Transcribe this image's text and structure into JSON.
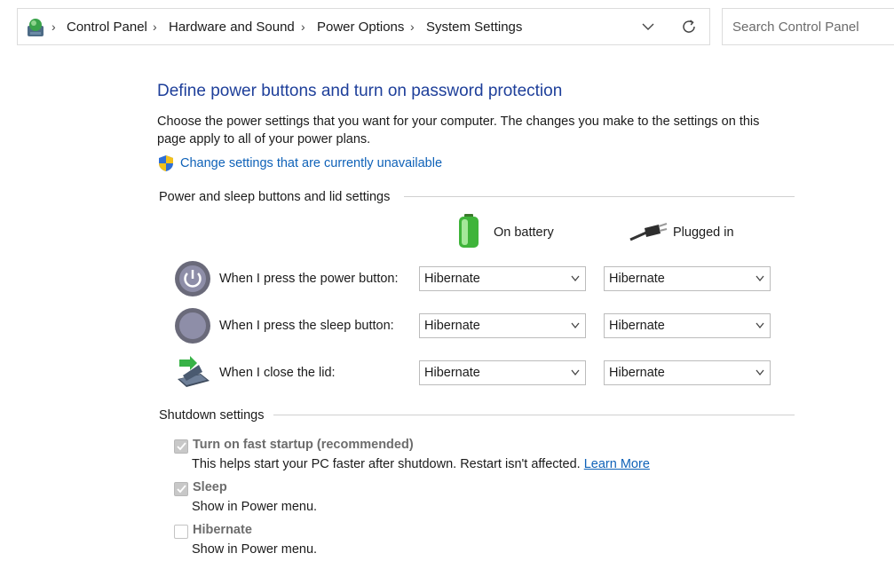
{
  "breadcrumb": {
    "items": [
      "Control Panel",
      "Hardware and Sound",
      "Power Options",
      "System Settings"
    ]
  },
  "search": {
    "placeholder": "Search Control Panel"
  },
  "page": {
    "title": "Define power buttons and turn on password protection",
    "description": "Choose the power settings that you want for your computer. The changes you make to the settings on this page apply to all of your power plans.",
    "change_link": "Change settings that are currently unavailable"
  },
  "buttons_section": {
    "heading": "Power and sleep buttons and lid settings",
    "columns": [
      "On battery",
      "Plugged in"
    ],
    "rows": [
      {
        "label": "When I press the power button:",
        "battery": "Hibernate",
        "plugged": "Hibernate"
      },
      {
        "label": "When I press the sleep button:",
        "battery": "Hibernate",
        "plugged": "Hibernate"
      },
      {
        "label": "When I close the lid:",
        "battery": "Hibernate",
        "plugged": "Hibernate"
      }
    ]
  },
  "shutdown_section": {
    "heading": "Shutdown settings",
    "options": [
      {
        "title": "Turn on fast startup (recommended)",
        "desc": "This helps start your PC faster after shutdown. Restart isn't affected.",
        "link": "Learn More",
        "checked": true
      },
      {
        "title": "Sleep",
        "desc": "Show in Power menu.",
        "checked": true
      },
      {
        "title": "Hibernate",
        "desc": "Show in Power menu.",
        "checked": false
      }
    ]
  },
  "icons": {
    "address": "control-panel-icon",
    "dropdown": "chevron-down-icon",
    "refresh": "refresh-icon",
    "shield": "uac-shield-icon",
    "battery": "battery-icon",
    "plug": "power-plug-icon",
    "power_button": "power-button-icon",
    "sleep_button": "sleep-button-icon",
    "lid": "laptop-lid-icon"
  },
  "colors": {
    "title": "#1e3f9a",
    "link": "#0f62b8",
    "disabled_text": "#6d6d6d"
  }
}
